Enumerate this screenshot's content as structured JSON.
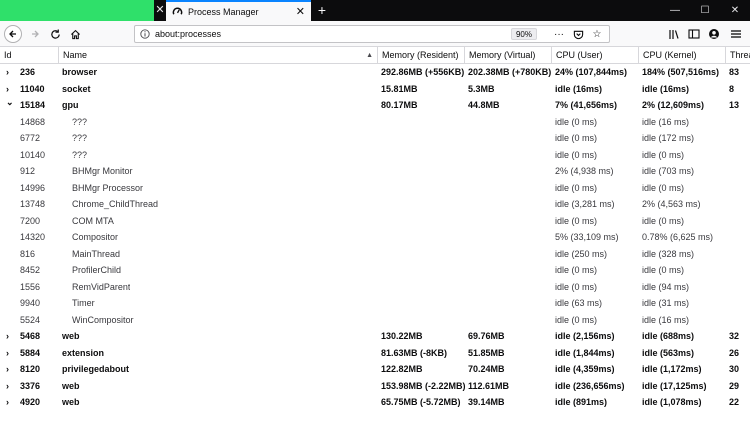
{
  "tab": {
    "title": "Process Manager"
  },
  "navbar": {
    "url": "about:processes",
    "zoom": "90%",
    "more": "···"
  },
  "columns": [
    "Id",
    "Name",
    "Memory (Resident)",
    "Memory (Virtual)",
    "CPU (User)",
    "CPU (Kernel)",
    "Threa"
  ],
  "rows": [
    {
      "type": "parent",
      "expanded": false,
      "id": "236",
      "name": "browser",
      "mem_res": "292.86MB (+556KB)",
      "mem_virt": "202.38MB (+780KB)",
      "cpu_user": "24% (107,844ms)",
      "cpu_kernel": "184% (507,516ms)",
      "threads": "83"
    },
    {
      "type": "parent",
      "expanded": false,
      "id": "11040",
      "name": "socket",
      "mem_res": "15.81MB",
      "mem_virt": "5.3MB",
      "cpu_user": "idle (16ms)",
      "cpu_kernel": "idle (16ms)",
      "threads": "8"
    },
    {
      "type": "parent",
      "expanded": true,
      "id": "15184",
      "name": "gpu",
      "mem_res": "80.17MB",
      "mem_virt": "44.8MB",
      "cpu_user": "7% (41,656ms)",
      "cpu_kernel": "2% (12,609ms)",
      "threads": "13"
    },
    {
      "type": "child",
      "id": "14868",
      "name": "???",
      "mem_res": "",
      "mem_virt": "",
      "cpu_user": "idle (0 ms)",
      "cpu_kernel": "idle (16 ms)",
      "threads": ""
    },
    {
      "type": "child",
      "id": "6772",
      "name": "???",
      "mem_res": "",
      "mem_virt": "",
      "cpu_user": "idle (0 ms)",
      "cpu_kernel": "idle (172 ms)",
      "threads": ""
    },
    {
      "type": "child",
      "id": "10140",
      "name": "???",
      "mem_res": "",
      "mem_virt": "",
      "cpu_user": "idle (0 ms)",
      "cpu_kernel": "idle (0 ms)",
      "threads": ""
    },
    {
      "type": "child",
      "id": "912",
      "name": "BHMgr Monitor",
      "mem_res": "",
      "mem_virt": "",
      "cpu_user": "2% (4,938 ms)",
      "cpu_kernel": "idle (703 ms)",
      "threads": ""
    },
    {
      "type": "child",
      "id": "14996",
      "name": "BHMgr Processor",
      "mem_res": "",
      "mem_virt": "",
      "cpu_user": "idle (0 ms)",
      "cpu_kernel": "idle (0 ms)",
      "threads": ""
    },
    {
      "type": "child",
      "id": "13748",
      "name": "Chrome_ChildThread",
      "mem_res": "",
      "mem_virt": "",
      "cpu_user": "idle (3,281 ms)",
      "cpu_kernel": "2% (4,563 ms)",
      "threads": ""
    },
    {
      "type": "child",
      "id": "7200",
      "name": "COM MTA",
      "mem_res": "",
      "mem_virt": "",
      "cpu_user": "idle (0 ms)",
      "cpu_kernel": "idle (0 ms)",
      "threads": ""
    },
    {
      "type": "child",
      "id": "14320",
      "name": "Compositor",
      "mem_res": "",
      "mem_virt": "",
      "cpu_user": "5% (33,109 ms)",
      "cpu_kernel": "0.78% (6,625 ms)",
      "threads": ""
    },
    {
      "type": "child",
      "id": "816",
      "name": "MainThread",
      "mem_res": "",
      "mem_virt": "",
      "cpu_user": "idle (250 ms)",
      "cpu_kernel": "idle (328 ms)",
      "threads": ""
    },
    {
      "type": "child",
      "id": "8452",
      "name": "ProfilerChild",
      "mem_res": "",
      "mem_virt": "",
      "cpu_user": "idle (0 ms)",
      "cpu_kernel": "idle (0 ms)",
      "threads": ""
    },
    {
      "type": "child",
      "id": "1556",
      "name": "RemVidParent",
      "mem_res": "",
      "mem_virt": "",
      "cpu_user": "idle (0 ms)",
      "cpu_kernel": "idle (94 ms)",
      "threads": ""
    },
    {
      "type": "child",
      "id": "9940",
      "name": "Timer",
      "mem_res": "",
      "mem_virt": "",
      "cpu_user": "idle (63 ms)",
      "cpu_kernel": "idle (31 ms)",
      "threads": ""
    },
    {
      "type": "child",
      "id": "5524",
      "name": "WinCompositor",
      "mem_res": "",
      "mem_virt": "",
      "cpu_user": "idle (0 ms)",
      "cpu_kernel": "idle (16 ms)",
      "threads": ""
    },
    {
      "type": "parent",
      "expanded": false,
      "id": "5468",
      "name": "web",
      "mem_res": "130.22MB",
      "mem_virt": "69.76MB",
      "cpu_user": "idle (2,156ms)",
      "cpu_kernel": "idle (688ms)",
      "threads": "32"
    },
    {
      "type": "parent",
      "expanded": false,
      "id": "5884",
      "name": "extension",
      "mem_res": "81.63MB (-8KB)",
      "mem_virt": "51.85MB",
      "cpu_user": "idle (1,844ms)",
      "cpu_kernel": "idle (563ms)",
      "threads": "26"
    },
    {
      "type": "parent",
      "expanded": false,
      "id": "8120",
      "name": "privilegedabout",
      "mem_res": "122.82MB",
      "mem_virt": "70.24MB",
      "cpu_user": "idle (4,359ms)",
      "cpu_kernel": "idle (1,172ms)",
      "threads": "30"
    },
    {
      "type": "parent",
      "expanded": false,
      "id": "3376",
      "name": "web",
      "mem_res": "153.98MB (-2.22MB)",
      "mem_virt": "112.61MB",
      "cpu_user": "idle (236,656ms)",
      "cpu_kernel": "idle (17,125ms)",
      "threads": "29"
    },
    {
      "type": "parent",
      "expanded": false,
      "id": "4920",
      "name": "web",
      "mem_res": "65.75MB (-5.72MB)",
      "mem_virt": "39.14MB",
      "cpu_user": "idle (891ms)",
      "cpu_kernel": "idle (1,078ms)",
      "threads": "22"
    }
  ]
}
